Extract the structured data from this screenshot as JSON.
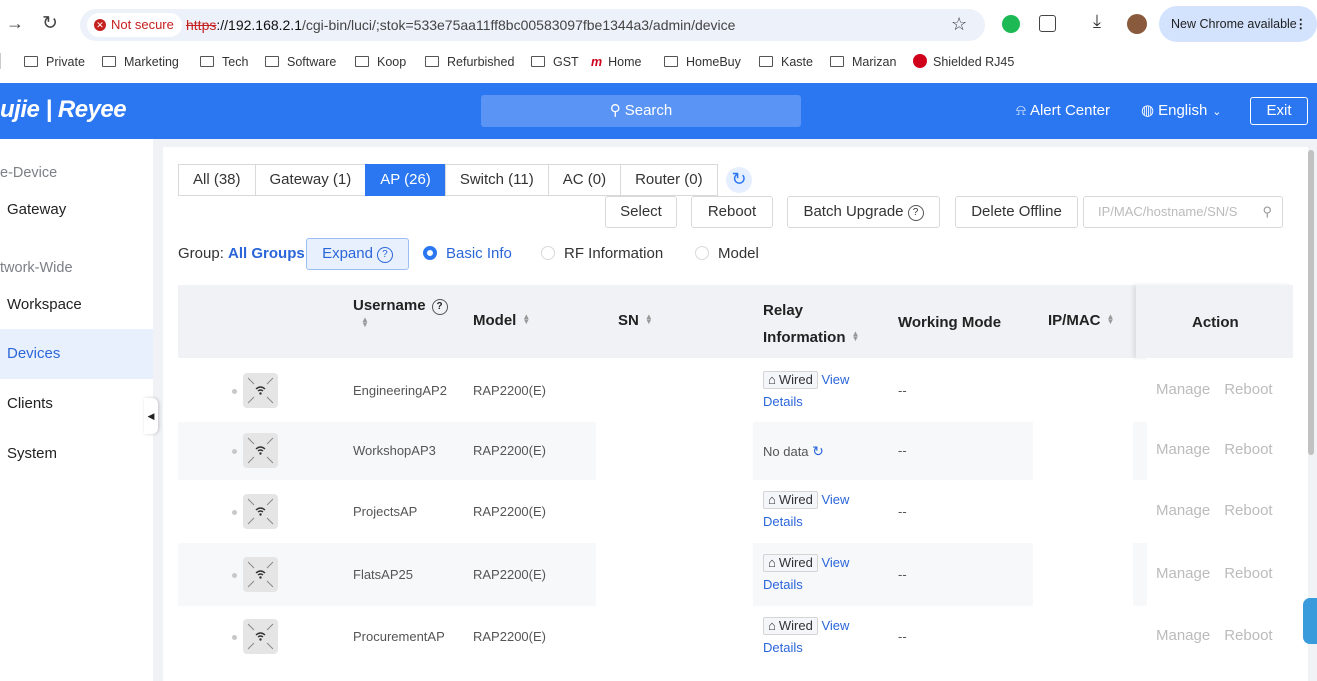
{
  "browser": {
    "security_label": "Not secure",
    "url_protocol": "https",
    "url_host": "://192.168.2.1",
    "url_path": "/cgi-bin/luci/;stok=533e75aa11ff8bc00583097fbe1344a3/admin/device",
    "new_chrome": "New Chrome available",
    "bookmarks": [
      "Private",
      "Marketing",
      "Tech",
      "Software",
      "Koop",
      "Refurbished",
      "GST",
      "Home",
      "HomeBuy",
      "Kaste",
      "Marizan",
      "Shielded RJ45"
    ]
  },
  "app": {
    "logo": "ujie | Reyee",
    "search_label": "Search",
    "alert_center": "Alert Center",
    "language": "English",
    "exit": "Exit"
  },
  "sidebar": {
    "group1": "e-Device",
    "group2": "twork-Wide",
    "items": [
      "Gateway",
      "Workspace",
      "Devices",
      "Clients",
      "System"
    ],
    "active": "Devices"
  },
  "tabs": [
    "All (38)",
    "Gateway (1)",
    "AP (26)",
    "Switch (11)",
    "AC (0)",
    "Router (0)"
  ],
  "active_tab": "AP (26)",
  "toolbar": {
    "select": "Select",
    "reboot": "Reboot",
    "batch_upgrade": "Batch Upgrade",
    "delete_offline": "Delete Offline",
    "filter_placeholder": "IP/MAC/hostname/SN/S"
  },
  "group_row": {
    "group_label": "Group:",
    "group_value": "All Groups",
    "expand": "Expand",
    "views": [
      "Basic Info",
      "RF Information",
      "Model"
    ],
    "selected_view": "Basic Info"
  },
  "table": {
    "columns": {
      "username": "Username",
      "model": "Model",
      "sn": "SN",
      "relay_line1": "Relay",
      "relay_line2": "Information",
      "working_mode": "Working Mode",
      "ip_mac": "IP/MAC",
      "action": "Action"
    },
    "rows": [
      {
        "username": "EngineeringAP2",
        "model": "RAP2200(E)",
        "relay": "Wired",
        "working_mode": "--"
      },
      {
        "username": "WorkshopAP3",
        "model": "RAP2200(E)",
        "relay": "No data",
        "working_mode": "--"
      },
      {
        "username": "ProjectsAP",
        "model": "RAP2200(E)",
        "relay": "Wired",
        "working_mode": "--"
      },
      {
        "username": "FlatsAP25",
        "model": "RAP2200(E)",
        "relay": "Wired",
        "working_mode": "--"
      },
      {
        "username": "ProcurementAP",
        "model": "RAP2200(E)",
        "relay": "Wired",
        "working_mode": "--"
      }
    ],
    "view_label": "View",
    "details_label": "Details",
    "manage_label": "Manage",
    "reboot_label": "Reboot"
  },
  "colors": {
    "brand": "#2b77f2",
    "link": "#2b66d9",
    "active_bg": "#e8f0fe"
  }
}
